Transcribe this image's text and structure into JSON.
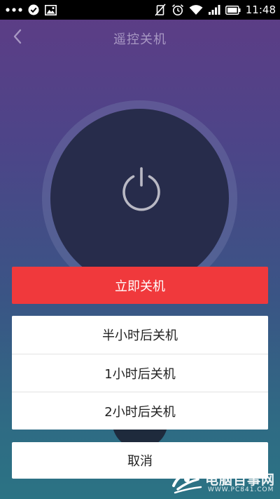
{
  "status_bar": {
    "time": "11:48",
    "icons": [
      "more-dots-icon",
      "check-circle-icon",
      "image-icon",
      "vibrate-off-icon",
      "alarm-icon",
      "wifi-icon",
      "signal-icon",
      "battery-icon"
    ]
  },
  "header": {
    "title": "遥控关机",
    "back_icon": "chevron-left-icon"
  },
  "power": {
    "icon": "power-icon"
  },
  "sheet": {
    "shutdown_now": "立即关机",
    "options": [
      "半小时后关机",
      "1小时后关机",
      "2小时后关机"
    ],
    "cancel": "取消"
  },
  "watermark": {
    "brand": "电脑百事网",
    "url": "WWW.PC841.COM"
  },
  "colors": {
    "accent_red": "#f0393c",
    "power_disc": "#272c4b",
    "title_text": "#a898c3"
  }
}
